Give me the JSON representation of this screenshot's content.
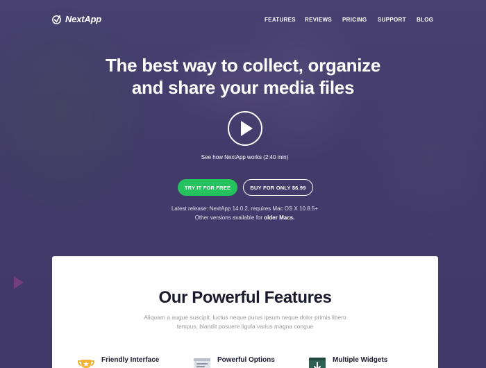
{
  "brand": {
    "name": "NextApp"
  },
  "nav": {
    "items": [
      "FEATURES",
      "REVIEWS",
      "PRICING",
      "SUPPORT",
      "BLOG"
    ]
  },
  "hero": {
    "headline_line1": "The best way to collect, organize",
    "headline_line2": "and share your media files",
    "video_caption": "See how NextApp works (2:40 min)",
    "try_button": "TRY IT FOR FREE",
    "buy_button": "BUY FOR ONLY $6.99",
    "release_text": "Latest release: NextApp 14.0.2, requires Mac OS X 10.8.5+",
    "other_versions_prefix": "Other versions available for ",
    "other_versions_link": "older Macs."
  },
  "features_section": {
    "title": "Our Powerful Features",
    "subtitle": "Aliquam a augue suscipit, luctus neque purus ipsum neque dolor primis libero tempus, blandit posuere ligula varius magna congue",
    "items": [
      {
        "title": "Friendly Interface",
        "icon": "trophy-icon"
      },
      {
        "title": "Powerful Options",
        "icon": "options-icon"
      },
      {
        "title": "Multiple Widgets",
        "icon": "widgets-icon"
      }
    ]
  },
  "colors": {
    "hero_bg": "#463f6e",
    "accent_green": "#26c25f",
    "text_dark": "#1a1a2e"
  }
}
